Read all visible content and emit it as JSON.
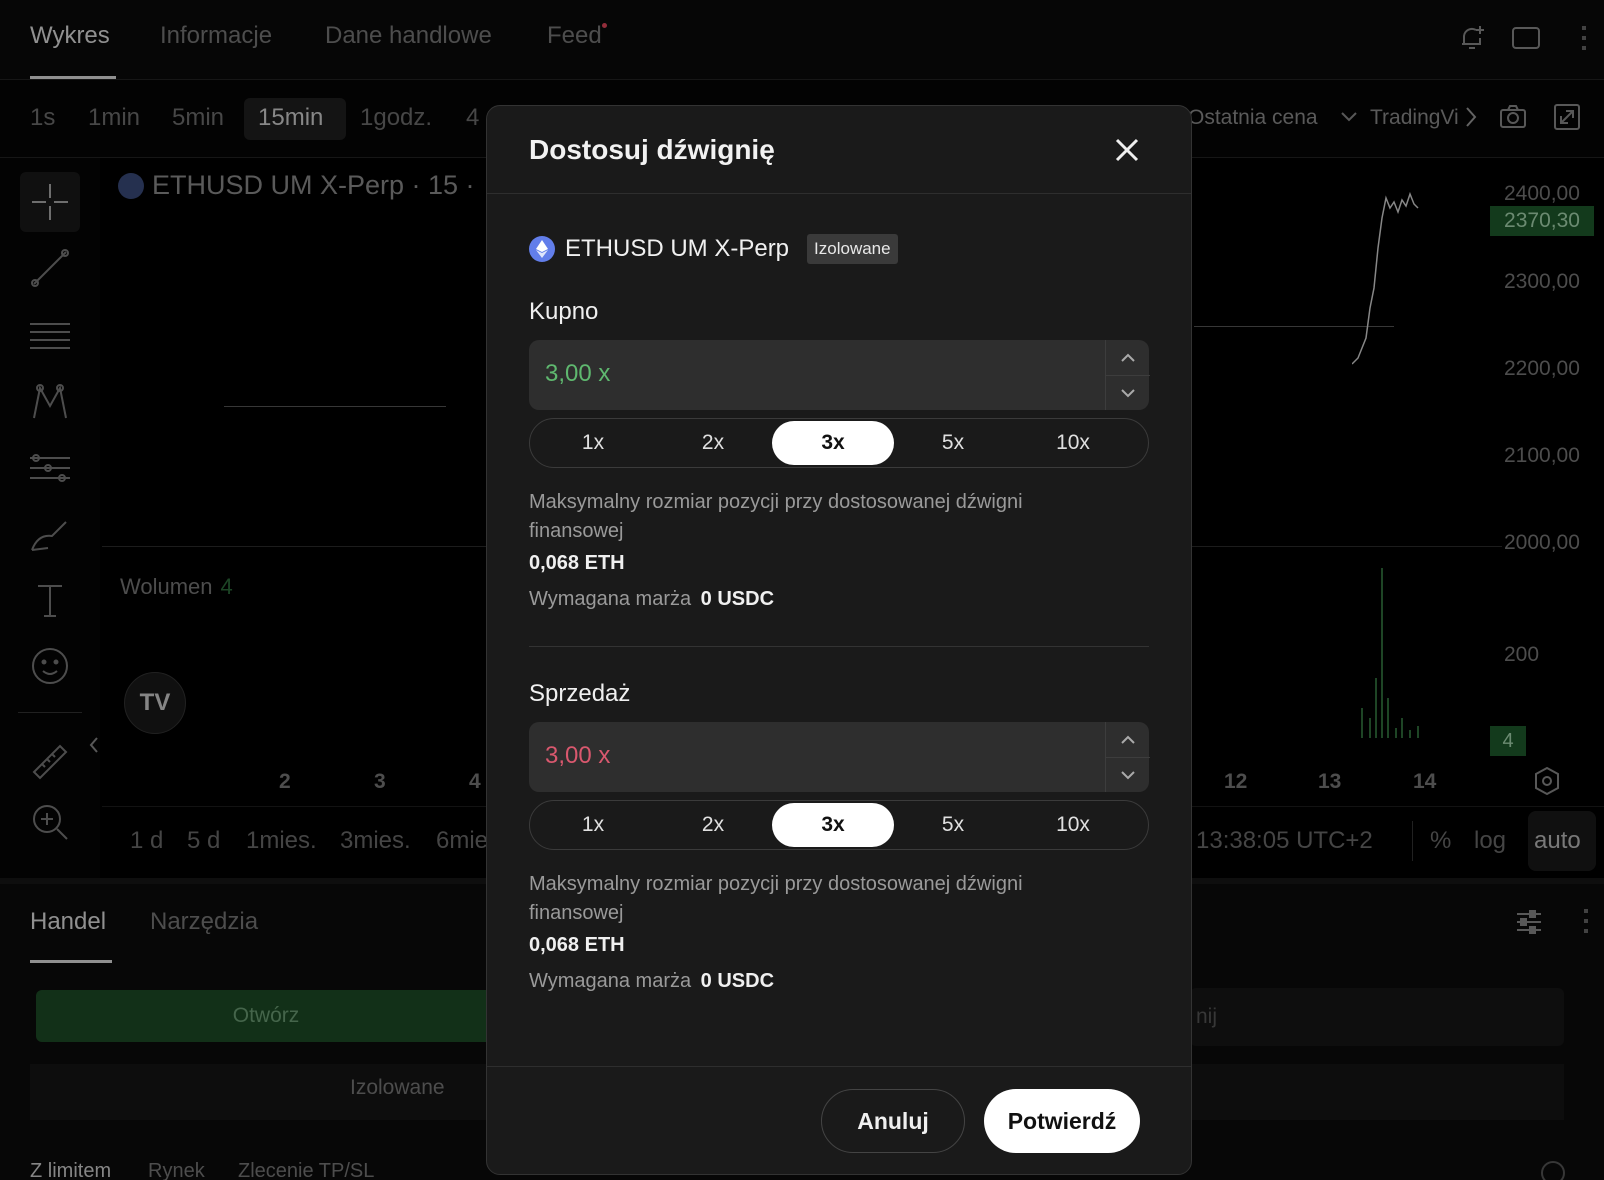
{
  "top_tabs": [
    "Wykres",
    "Informacje",
    "Dane handlowe",
    "Feed"
  ],
  "intervals": [
    "1s",
    "1min",
    "5min",
    "15min",
    "1godz.",
    "4"
  ],
  "toolbar_right": {
    "price_type": "Ostatnia cena",
    "provider": "TradingVi"
  },
  "chart": {
    "symbol_title": "ETHUSD UM X-Perp · 15 ·",
    "volume_label": "Wolumen",
    "volume_value": "4",
    "y_labels": [
      "2400,00",
      "2300,00",
      "2200,00",
      "2100,00",
      "2000,00",
      "200"
    ],
    "last_price": "2370,30",
    "volume_tag": "4",
    "x_labels_left": [
      "2",
      "3",
      "4"
    ],
    "x_labels_right": [
      "12",
      "13",
      "14"
    ],
    "ranges": [
      "1 d",
      "5 d",
      "1mies.",
      "3mies.",
      "6mie"
    ],
    "time": "13:38:05 UTC+2",
    "scale_opts": [
      "%",
      "log",
      "auto"
    ]
  },
  "bottom": {
    "tabs": [
      "Handel",
      "Narzędzia"
    ],
    "open_label": "Otwórz",
    "right_label": "nij",
    "margin_mode": "Izolowane",
    "order_types": [
      "Z limitem",
      "Rynek",
      "Zlecenie TP/SL"
    ]
  },
  "modal": {
    "title": "Dostosuj dźwignię",
    "symbol": "ETHUSD UM X-Perp",
    "badge": "Izolowane",
    "buy": {
      "label": "Kupno",
      "value": "3,00 x",
      "presets": [
        "1x",
        "2x",
        "3x",
        "5x",
        "10x"
      ],
      "selected": "3x",
      "max_text": "Maksymalny rozmiar pozycji przy dostosowanej dźwigni finansowej",
      "max_value": "0,068 ETH",
      "margin_label": "Wymagana marża",
      "margin_value": "0 USDC"
    },
    "sell": {
      "label": "Sprzedaż",
      "value": "3,00 x",
      "presets": [
        "1x",
        "2x",
        "3x",
        "5x",
        "10x"
      ],
      "selected": "3x",
      "max_text": "Maksymalny rozmiar pozycji przy dostosowanej dźwigni finansowej",
      "max_value": "0,068 ETH",
      "margin_label": "Wymagana marża",
      "margin_value": "0 USDC"
    },
    "cancel_label": "Anuluj",
    "confirm_label": "Potwierdź"
  },
  "colors": {
    "buy_value": "#5fb86f",
    "sell_value": "#d9586e",
    "price_tag": "#1e5a2c"
  },
  "icons": {
    "close": "close-icon",
    "bell": "bell-plus-icon",
    "window": "window-icon",
    "camera": "camera-icon",
    "expand": "expand-icon",
    "eth": "ethereum-icon"
  }
}
